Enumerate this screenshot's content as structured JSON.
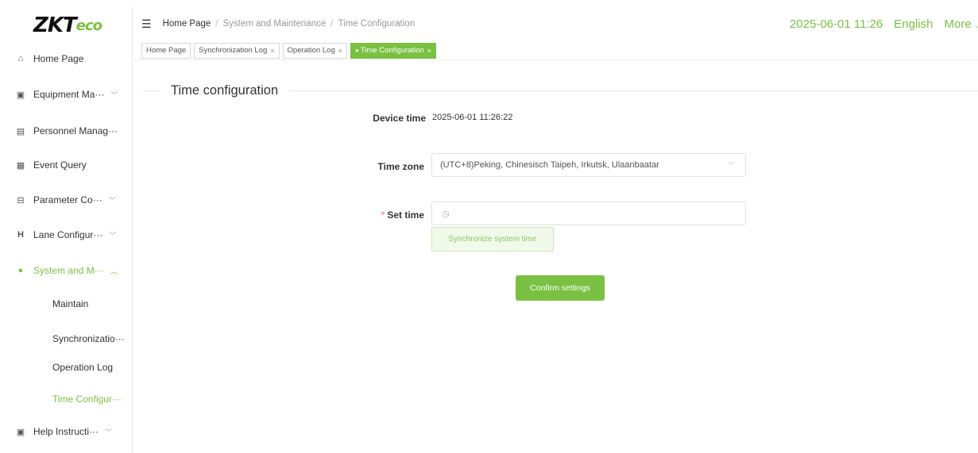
{
  "logo": {
    "brand": "ZKT",
    "suffix": "eco"
  },
  "sidebar": {
    "items": [
      {
        "label": "Home Page",
        "icon": "home-icon"
      },
      {
        "label": "Equipment Ma···",
        "icon": "device-icon"
      },
      {
        "label": "Personnel Manag···",
        "icon": "person-card-icon"
      },
      {
        "label": "Event Query",
        "icon": "event-icon"
      },
      {
        "label": "Parameter Co···",
        "icon": "parameter-icon"
      },
      {
        "label": "Lane Configur···",
        "icon": "lane-icon"
      },
      {
        "label": "System and M···",
        "icon": "system-icon"
      },
      {
        "label": "Help Instructi···",
        "icon": "help-icon"
      }
    ],
    "sub_items": [
      {
        "label": "Maintain"
      },
      {
        "label": "Synchronizatio···"
      },
      {
        "label": "Operation Log"
      },
      {
        "label": "Time Configur···"
      }
    ]
  },
  "header": {
    "breadcrumb": [
      "Home Page",
      "System and Maintenance",
      "Time Configuration"
    ],
    "datetime": "2025-06-01 11:26",
    "language": "English",
    "more": "More ."
  },
  "tabs": [
    {
      "label": "Home Page"
    },
    {
      "label": "Synchronization Log"
    },
    {
      "label": "Operation Log"
    },
    {
      "label": "Time Configuration"
    }
  ],
  "main": {
    "section_title": "Time configuration",
    "device_time_label": "Device time",
    "device_time_value": "2025-06-01 11:26:22",
    "time_zone_label": "Time zone",
    "time_zone_value": "(UTC+8)Peking, Chinesisch Taipeh, Irkutsk, Ulaanbaatar",
    "set_time_label": "Set time",
    "sync_button": "Synchronize system time",
    "confirm_button": "Confirm settings"
  },
  "colors": {
    "accent": "#7ac143",
    "required": "#f56c6c"
  }
}
